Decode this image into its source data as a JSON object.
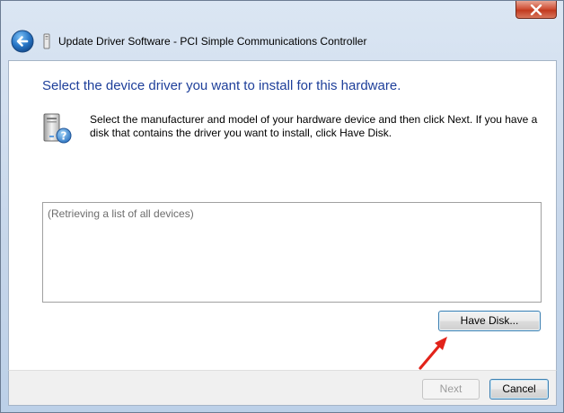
{
  "window": {
    "title": "Update Driver Software - PCI Simple Communications Controller",
    "close_glyph": "✕"
  },
  "icons": {
    "back": "back-arrow-icon",
    "title": "device-manager-icon",
    "hardware": "hardware-question-icon",
    "close": "close-icon"
  },
  "content": {
    "heading": "Select the device driver you want to install for this hardware.",
    "description": "Select the manufacturer and model of your hardware device and then click Next. If you have a disk that contains the driver you want to install, click Have Disk.",
    "device_list": {
      "items": [
        "(Retrieving a list of all devices)"
      ]
    },
    "have_disk_label": "Have Disk..."
  },
  "footer": {
    "next_label": "Next",
    "cancel_label": "Cancel"
  },
  "colors": {
    "heading": "#1e3f9a",
    "annotation_arrow": "#e2231a",
    "close_button": "#c94a2e"
  }
}
